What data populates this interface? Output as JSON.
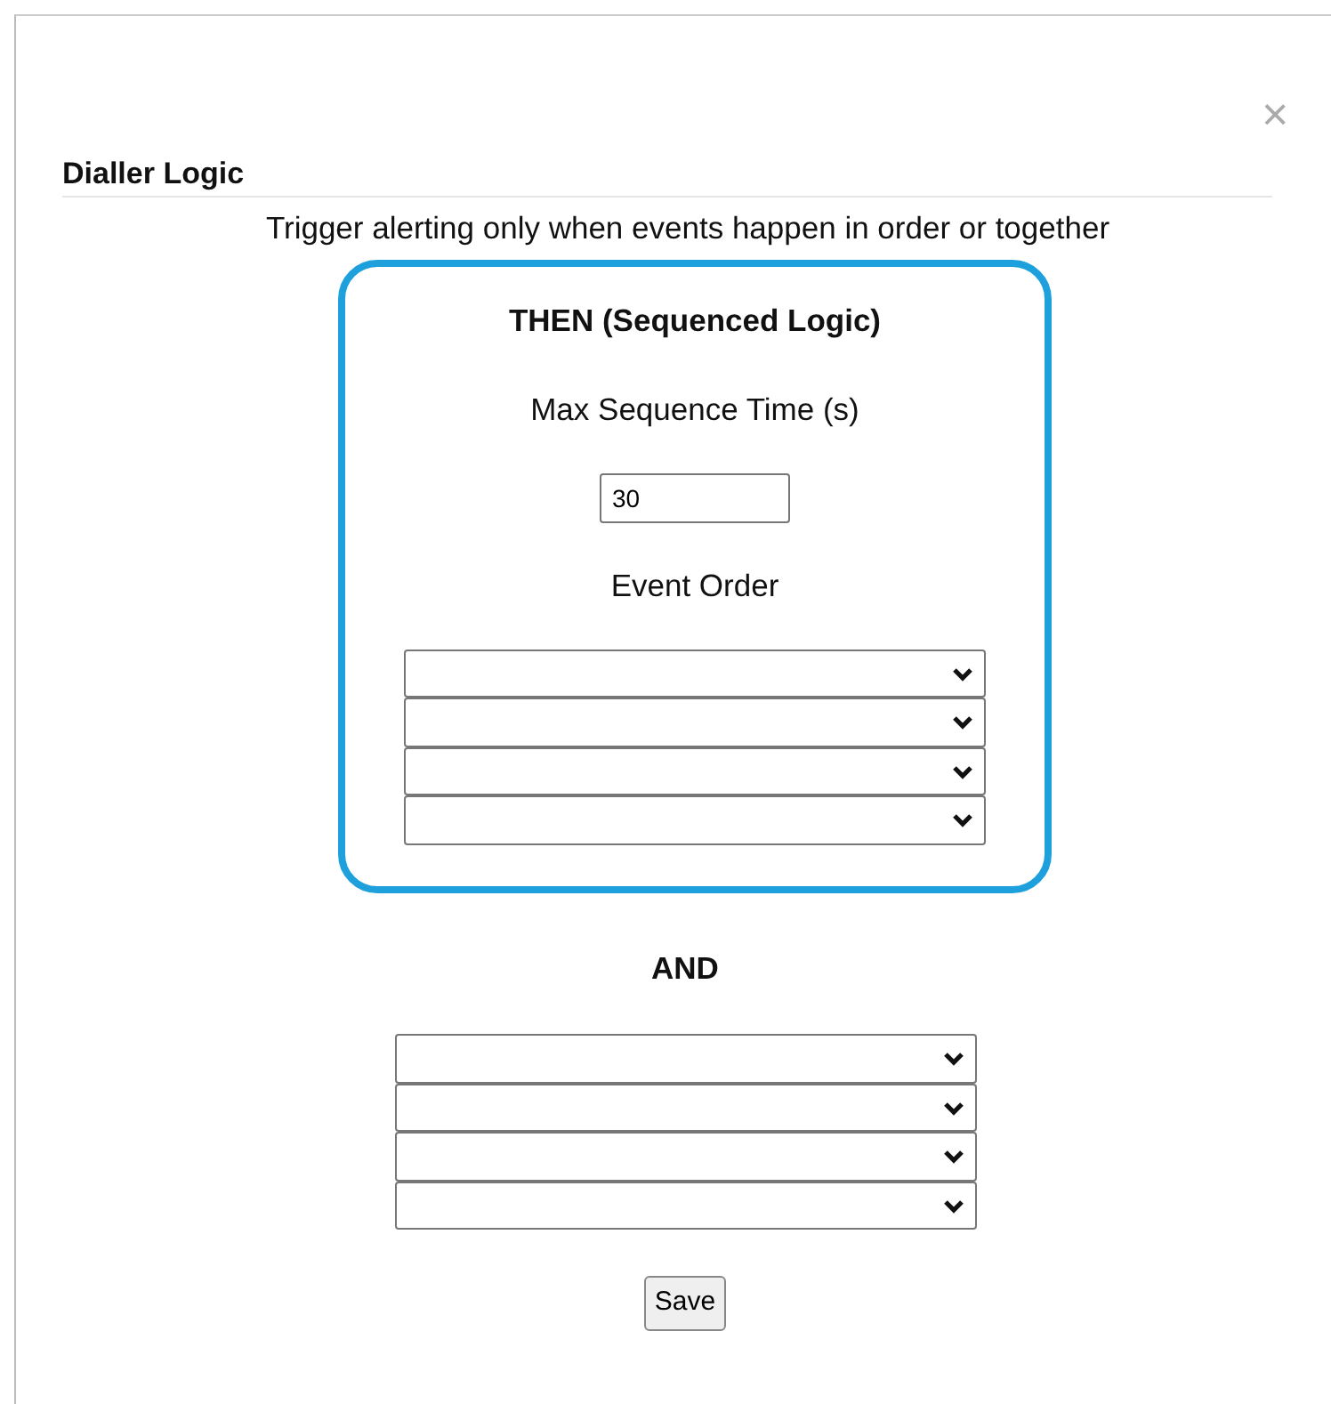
{
  "dialog": {
    "title": "Dialler Logic",
    "close": "×"
  },
  "description": "Trigger alerting only when events happen in order or together",
  "sequence": {
    "heading": "THEN (Sequenced Logic)",
    "time_label": "Max Sequence Time (s)",
    "time_value": "30",
    "order_label": "Event Order",
    "dropdowns": [
      {
        "kind": "select"
      },
      {
        "kind": "select"
      },
      {
        "kind": "select"
      },
      {
        "kind": "select"
      }
    ]
  },
  "and": {
    "heading": "AND",
    "dropdowns": [
      {
        "kind": "select"
      },
      {
        "kind": "select"
      },
      {
        "kind": "select"
      },
      {
        "kind": "select"
      }
    ]
  },
  "save": "Save"
}
